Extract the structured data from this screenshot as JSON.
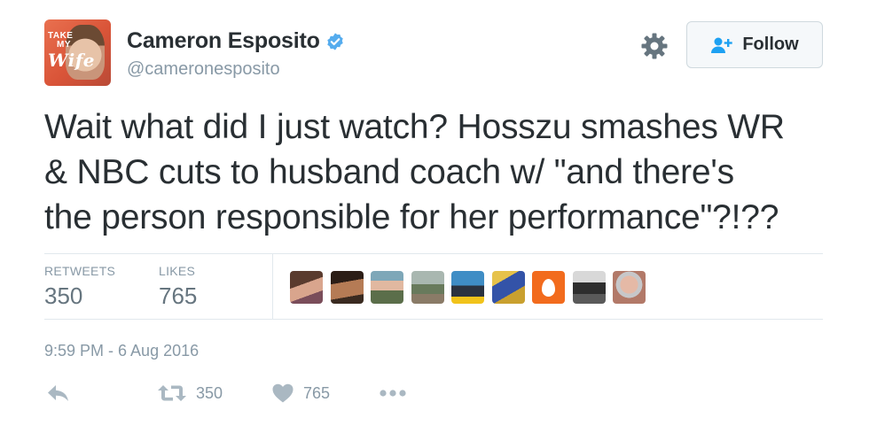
{
  "author": {
    "display_name": "Cameron Esposito",
    "handle": "@cameronesposito",
    "avatar_text_1": "TAKE",
    "avatar_text_2": "MY",
    "avatar_text_3": "Wife",
    "verified": true
  },
  "follow_button": {
    "label": "Follow"
  },
  "tweet": {
    "text_line_1": "Wait what did I just watch? Hosszu smashes WR",
    "text_line_2": "& NBC cuts to husband coach w/ \"and there's",
    "text_line_3": "the person responsible for her performance\"?!??",
    "timestamp": "9:59 PM - 6 Aug 2016"
  },
  "stats": {
    "retweets_label": "RETWEETS",
    "retweets_value": "350",
    "likes_label": "LIKES",
    "likes_value": "765"
  },
  "actions": {
    "retweet_count": "350",
    "like_count": "765"
  },
  "colors": {
    "text": "#292f33",
    "muted": "#8899a6",
    "verified_blue": "#55acee",
    "follow_icon_blue": "#1da1f2",
    "divider": "#e1e8ed"
  },
  "icons": [
    "verified-icon",
    "gear-icon",
    "add-user-icon",
    "reply-icon",
    "retweet-icon",
    "heart-icon",
    "more-icon"
  ]
}
